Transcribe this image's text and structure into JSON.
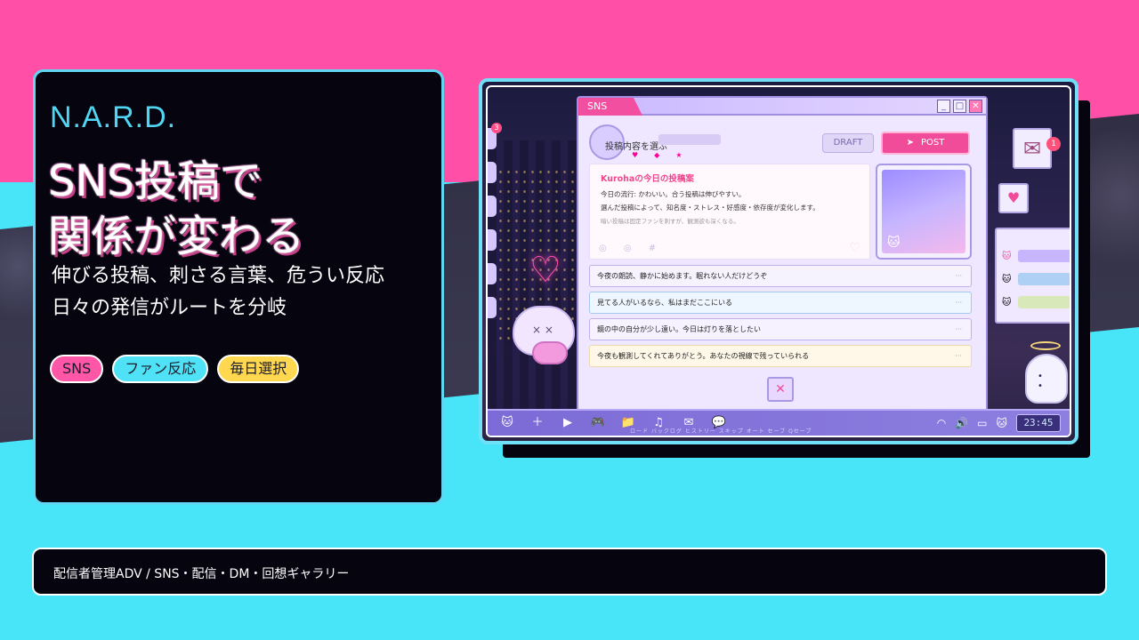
{
  "colors": {
    "pink": "#ff4fa6",
    "cyan": "#48e4f8",
    "card_bg": "#05040f",
    "accent_cyan": "#4fd6f3",
    "tag_yellow": "#ffd84f"
  },
  "info": {
    "brand": "N.A.R.D.",
    "headline": "SNS投稿で\n関係が変わる",
    "subcopy": "伸びる投稿、刺さる言葉、危うい反応\n日々の発信がルートを分岐",
    "tags": [
      "SNS",
      "ファン反応",
      "毎日選択"
    ]
  },
  "caption": "配信者管理ADV / SNS・配信・DM・回想ギャラリー",
  "screenshot": {
    "window_tab": "SNS",
    "window_buttons": {
      "minimize": "_",
      "maximize": "□",
      "close": "✕"
    },
    "compose_label": "投稿内容を選ぶ",
    "draft_button": "DRAFT",
    "post_button": "POST",
    "draft_card": {
      "title": "Kurohaの今日の投稿案",
      "line1": "今日の流行: かわいい。合う投稿は伸びやすい。",
      "line2": "選んだ投稿によって、知名度・ストレス・好感度・依存度が変化します。",
      "line3": "暗い投稿は固定ファンを刺すが、観測欲も深くなる。"
    },
    "posts": [
      "今夜の朗読、静かに始めます。眠れない人だけどうぞ",
      "見てる人がいるなら、私はまだここにいる",
      "鏡の中の自分が少し遠い。今日は灯りを落としたい",
      "今夜も観測してくれてありがとう。あなたの視線で残っていられる"
    ],
    "post_more": "···",
    "close_glyph": "✕",
    "side_badge": "3",
    "mail_badge": "1",
    "taskbar": {
      "labels": "ロード  バックログ  ヒストリー  スキップ  オート  セーブ  Qセーブ",
      "clock": "23:45"
    },
    "icons": [
      "cat-icon",
      "plus-icon",
      "play-icon",
      "gamepad-icon",
      "folder-icon",
      "music-icon",
      "mail-icon",
      "chat-icon",
      "wifi-icon",
      "speaker-icon",
      "battery-icon"
    ]
  }
}
